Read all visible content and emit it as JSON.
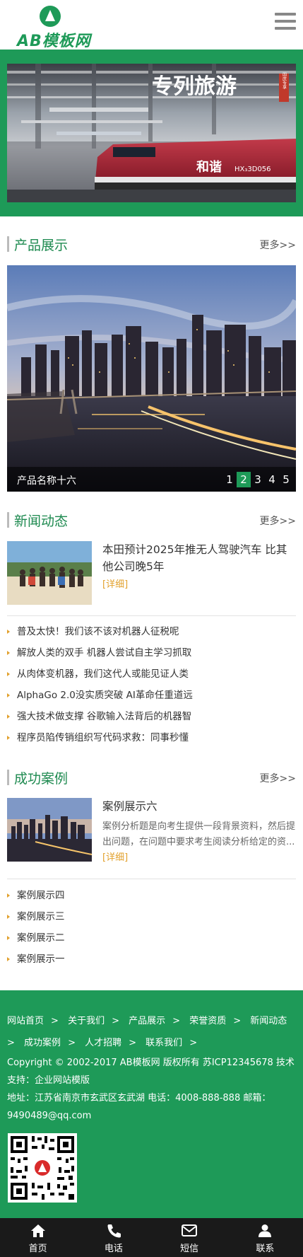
{
  "header": {
    "logo_text": "AB模板网"
  },
  "banner": {
    "headline": "专列旅游",
    "stamp": "国庆专享",
    "train_text": "和谐",
    "train_code": "HX₃3D056"
  },
  "products": {
    "title": "产品展示",
    "more": "更多>>",
    "slide_caption": "产品名称十六",
    "pages": [
      "1",
      "2",
      "3",
      "4",
      "5"
    ],
    "active_page": "2"
  },
  "news": {
    "title": "新闻动态",
    "more": "更多>>",
    "feature_title": "本田预计2025年推无人驾驶汽车 比其他公司晚5年",
    "feature_detail": "[详细]",
    "items": [
      "普及太快！我们该不该对机器人征税呢",
      "解放人类的双手 机器人尝试自主学习抓取",
      "从肉体变机器，我们这代人或能见证人类",
      "AlphaGo 2.0没实质突破 AI革命任重道远",
      "强大技术做支撑 谷歌输入法背后的机器智",
      "程序员陷传销组织写代码求救：同事秒懂"
    ]
  },
  "cases": {
    "title": "成功案例",
    "more": "更多>>",
    "feature_title": "案例展示六",
    "feature_desc": "案例分析题是向考生提供一段背景资料，然后提出问题，在问题中要求考生阅读分析给定的资...",
    "feature_detail": "[详细]",
    "items": [
      "案例展示四",
      "案例展示三",
      "案例展示二",
      "案例展示一"
    ]
  },
  "footer": {
    "nav": [
      "网站首页",
      "关于我们",
      "产品展示",
      "荣誉资质",
      "新闻动态",
      "成功案例",
      "人才招聘",
      "联系我们"
    ],
    "nav_sep": ">",
    "copyright": "Copyright © 2002-2017 AB模板网 版权所有 苏ICP12345678 技术支持：企业网站模版",
    "address": "地址：江苏省南京市玄武区玄武湖 电话：4008-888-888 邮箱：9490489@qq.com"
  },
  "tabbar": {
    "items": [
      {
        "label": "首页",
        "icon": "home-icon"
      },
      {
        "label": "电话",
        "icon": "phone-icon"
      },
      {
        "label": "短信",
        "icon": "mail-icon"
      },
      {
        "label": "联系",
        "icon": "user-icon"
      }
    ]
  },
  "colors": {
    "brand": "#1e9a58",
    "accent": "#e2a12d",
    "tabbar": "#1a1a1a"
  }
}
